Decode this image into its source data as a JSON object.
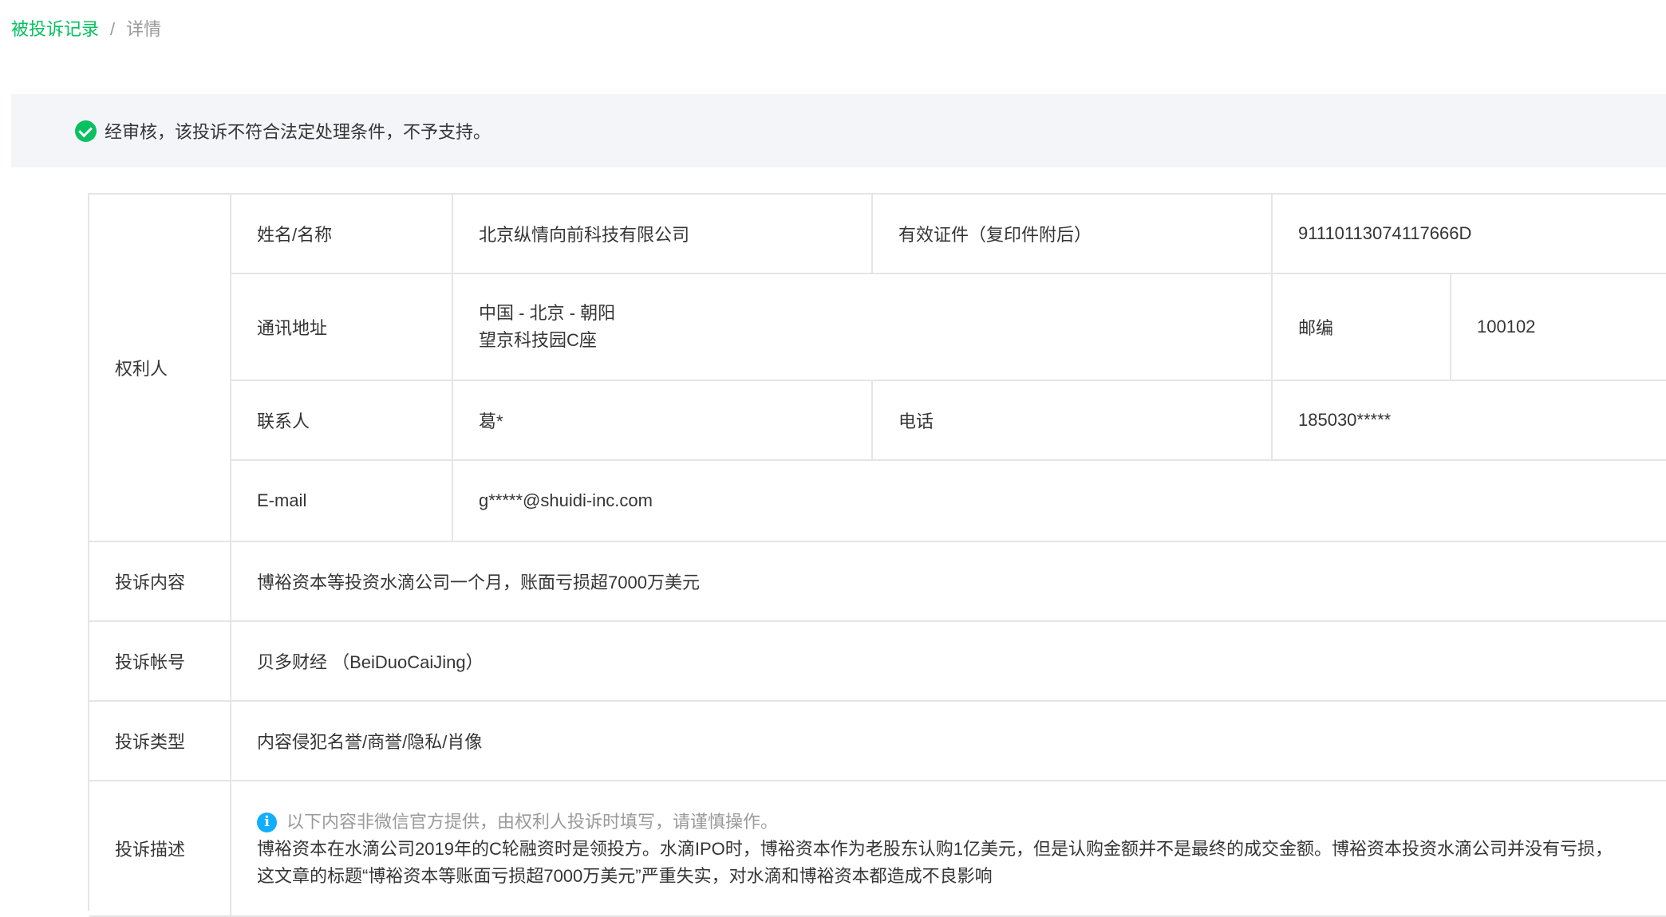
{
  "breadcrumb": {
    "parent": "被投诉记录",
    "separator": "/",
    "current": "详情"
  },
  "notice": {
    "icon": "check-circle-icon",
    "text": "经审核，该投诉不符合法定处理条件，不予支持。"
  },
  "rights_holder": {
    "section_label": "权利人",
    "name_label": "姓名/名称",
    "name_value": "北京纵情向前科技有限公司",
    "license_label": "有效证件（复印件附后）",
    "license_value": "91110113074117666D",
    "address_label": "通讯地址",
    "address_line1": "中国 - 北京 - 朝阳",
    "address_line2": "望京科技园C座",
    "zip_label": "邮编",
    "zip_value": "100102",
    "contact_label": "联系人",
    "contact_value": "葛*",
    "phone_label": "电话",
    "phone_value": "185030*****",
    "email_label": "E-mail",
    "email_value": "g*****@shuidi-inc.com"
  },
  "complaint": {
    "content_label": "投诉内容",
    "content_value": "博裕资本等投资水滴公司一个月，账面亏损超7000万美元",
    "account_label": "投诉帐号",
    "account_value": "贝多财经 （BeiDuoCaiJing）",
    "type_label": "投诉类型",
    "type_value": "内容侵犯名誉/商誉/隐私/肖像",
    "desc_label": "投诉描述",
    "desc_tip": "以下内容非微信官方提供，由权利人投诉时填写，请谨慎操作。",
    "desc_line1": "博裕资本在水滴公司2019年的C轮融资时是领投方。水滴IPO时，博裕资本作为老股东认购1亿美元，但是认购金额并不是最终的成交金额。博裕资本投资水滴公司并没有亏损，",
    "desc_line2": "这文章的标题“博裕资本等账面亏损超7000万美元”严重失实，对水滴和博裕资本都造成不良影响"
  }
}
